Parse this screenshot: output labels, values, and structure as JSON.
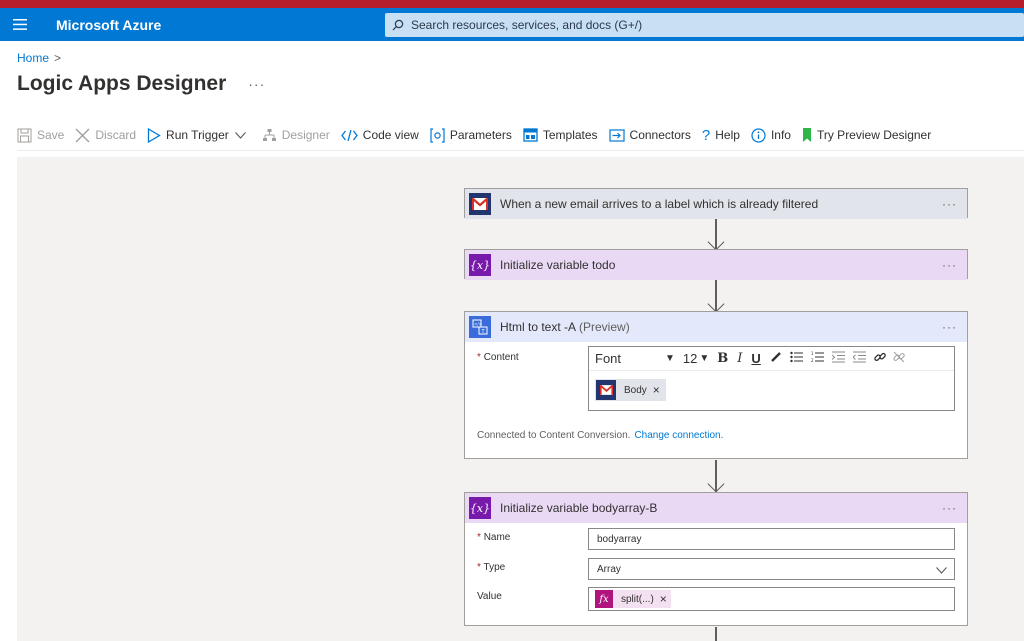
{
  "topbar": {
    "brand": "Microsoft Azure",
    "search_placeholder": "Search resources, services, and docs (G+/)"
  },
  "breadcrumb": {
    "home": "Home",
    "separator": ">"
  },
  "page": {
    "title": "Logic Apps Designer",
    "more": "···"
  },
  "toolbar": {
    "save": "Save",
    "discard": "Discard",
    "run_trigger": "Run Trigger",
    "designer": "Designer",
    "code_view": "Code view",
    "parameters": "Parameters",
    "templates": "Templates",
    "connectors": "Connectors",
    "help": "Help",
    "info": "Info",
    "try_preview": "Try Preview Designer"
  },
  "cards": {
    "trigger": {
      "title": "When a new email arrives to a label which is already filtered",
      "more": "···"
    },
    "init_todo": {
      "title": "Initialize variable todo",
      "more": "···",
      "icon_text": "{x}"
    },
    "html_to_text": {
      "title": "Html to text -A",
      "suffix": "(Preview)",
      "more": "···",
      "content_label": "Content",
      "required": "*",
      "font_label": "Font",
      "font_size": "12",
      "token_label": "Body",
      "token_close": "×",
      "connected_text": "Connected to Content Conversion.",
      "change_connection": "Change connection."
    },
    "init_bodyarray": {
      "title": "Initialize variable bodyarray-B",
      "more": "···",
      "icon_text": "{x}",
      "required": "*",
      "name_label": "Name",
      "name_value": "bodyarray",
      "type_label": "Type",
      "type_value": "Array",
      "value_label": "Value",
      "fn_icon": "fx",
      "fn_value": "split(...)",
      "fn_close": "×"
    }
  },
  "colors": {
    "accent": "#0078d4",
    "variable_icon": "#7719aa",
    "gmail_icon_bg": "#22356e",
    "expression_icon": "#b0157e"
  }
}
